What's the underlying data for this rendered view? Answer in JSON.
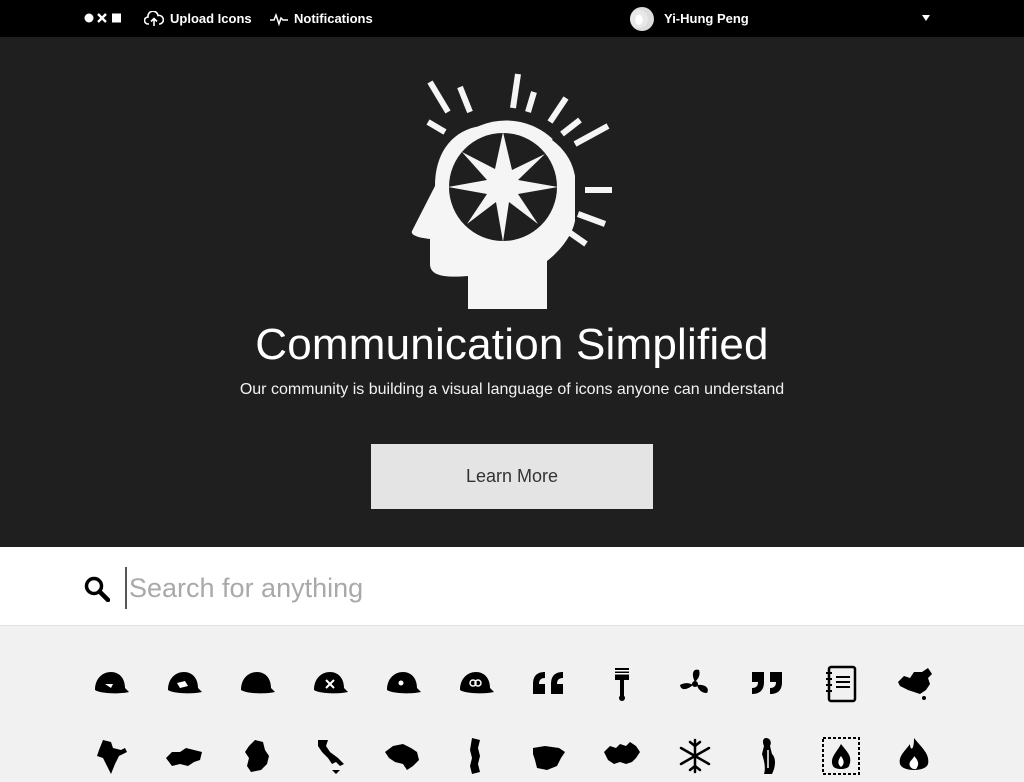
{
  "nav": {
    "logo_icon": "nounproject-logo-icon",
    "upload_label": "Upload Icons",
    "upload_icon": "cloud-upload-icon",
    "notifications_label": "Notifications",
    "notifications_icon": "pulse-icon",
    "user_name": "Yi-Hung Peng",
    "dropdown_icon": "caret-down-icon"
  },
  "hero": {
    "illustration_icon": "head-burst-idea-icon",
    "title": "Communication Simplified",
    "subtitle": "Our community is building a visual language of icons anyone can understand",
    "button_label": "Learn More"
  },
  "search": {
    "placeholder": "Search for anything",
    "icon": "search-icon"
  },
  "icons": {
    "row1": [
      "cap-icon",
      "cap-icon",
      "cap-icon",
      "cap-icon",
      "cap-icon",
      "cap-icon",
      "quote-open-icon",
      "piston-icon",
      "fan-icon",
      "quote-close-icon",
      "notebook-icon",
      "china-map-icon"
    ],
    "row2": [
      "india-map-icon",
      "switzerland-map-icon",
      "ireland-map-icon",
      "italy-map-icon",
      "belgium-map-icon",
      "portugal-map-icon",
      "spain-map-icon",
      "canada-map-icon",
      "snowflake-icon",
      "figure-icon",
      "fire-pattern-icon",
      "flame-icon"
    ]
  },
  "colors": {
    "topbar": "#000000",
    "hero": "#1f1f1f",
    "button": "#e4e4e4",
    "grid_bg": "#f1f1f1"
  }
}
